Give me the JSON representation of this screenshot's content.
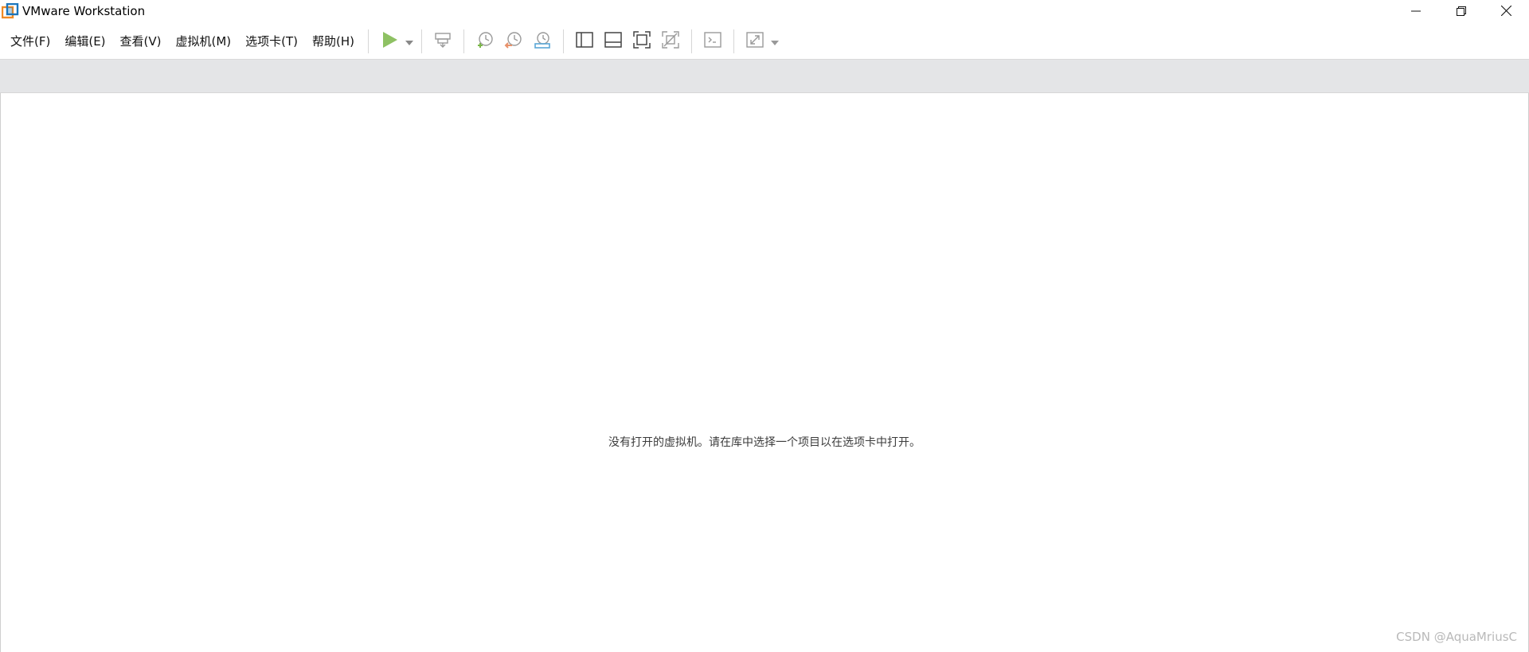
{
  "window": {
    "title": "VMware Workstation",
    "logo_icon": "vmware-logo-icon",
    "controls": [
      {
        "name": "minimize",
        "icon": "minimize-icon"
      },
      {
        "name": "restore",
        "icon": "restore-icon"
      },
      {
        "name": "close",
        "icon": "close-icon"
      }
    ]
  },
  "menu": {
    "items": [
      "文件(F)",
      "编辑(E)",
      "查看(V)",
      "虚拟机(M)",
      "选项卡(T)",
      "帮助(H)"
    ]
  },
  "toolbar": {
    "power_on": {
      "icon": "play-icon",
      "color": "#7ab648"
    },
    "buttons": [
      "send-ctrl-alt-del-icon",
      "take-snapshot-icon",
      "revert-snapshot-icon",
      "snapshot-manager-icon",
      "show-library-icon",
      "show-thumbnail-bar-icon",
      "full-screen-icon",
      "unity-icon",
      "console-view-icon",
      "stretch-guest-icon"
    ]
  },
  "content": {
    "empty_message": "没有打开的虚拟机。请在库中选择一个项目以在选项卡中打开。",
    "watermark": "CSDN @AquaMriusC"
  },
  "colors": {
    "tabstrip_bg": "#e4e5e7",
    "accent_green": "#7ab648",
    "snapshot_orange": "#e8926a",
    "snapshot_blue": "#5aa7d6",
    "logo_orange": "#f08a24",
    "logo_blue": "#1b75bb"
  }
}
